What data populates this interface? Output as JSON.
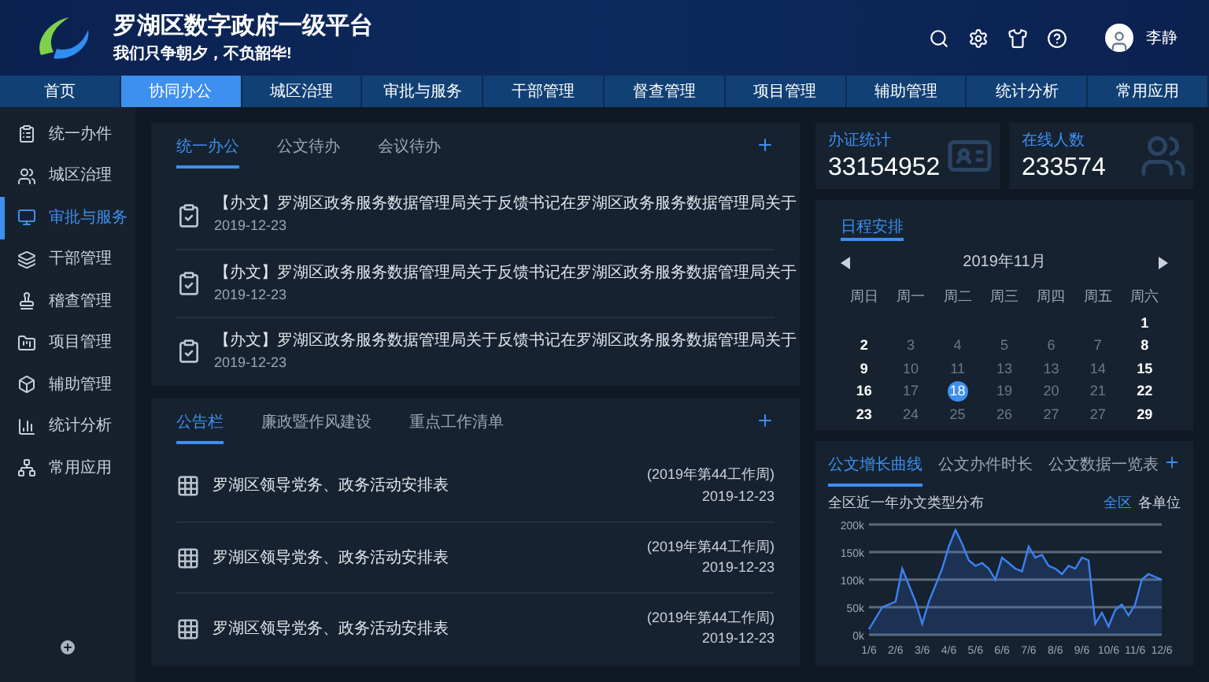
{
  "header": {
    "title": "罗湖区数字政府一级平台",
    "slogan": "我们只争朝夕，不负韶华!",
    "user": "李静"
  },
  "nav": [
    {
      "label": "首页",
      "selected": false
    },
    {
      "label": "协同办公",
      "selected": true
    },
    {
      "label": "城区治理",
      "selected": false
    },
    {
      "label": "审批与服务",
      "selected": false
    },
    {
      "label": "干部管理",
      "selected": false
    },
    {
      "label": "督查管理",
      "selected": false
    },
    {
      "label": "项目管理",
      "selected": false
    },
    {
      "label": "辅助管理",
      "selected": false
    },
    {
      "label": "统计分析",
      "selected": false
    },
    {
      "label": "常用应用",
      "selected": false
    }
  ],
  "sidebar": {
    "items": [
      {
        "label": "统一办件",
        "selected": false
      },
      {
        "label": "城区治理",
        "selected": false
      },
      {
        "label": "审批与服务",
        "selected": true
      },
      {
        "label": "干部管理",
        "selected": false
      },
      {
        "label": "稽查管理",
        "selected": false
      },
      {
        "label": "项目管理",
        "selected": false
      },
      {
        "label": "辅助管理",
        "selected": false
      },
      {
        "label": "统计分析",
        "selected": false
      },
      {
        "label": "常用应用",
        "selected": false
      }
    ]
  },
  "office": {
    "tabs": [
      {
        "label": "统一办公",
        "selected": true
      },
      {
        "label": "公文待办",
        "selected": false
      },
      {
        "label": "会议待办",
        "selected": false
      }
    ],
    "items": [
      {
        "title": "【办文】罗湖区政务服务数据管理局关于反馈书记在罗湖区政务服务数据管理局关于",
        "date": "2019-12-23"
      },
      {
        "title": "【办文】罗湖区政务服务数据管理局关于反馈书记在罗湖区政务服务数据管理局关于",
        "date": "2019-12-23"
      },
      {
        "title": "【办文】罗湖区政务服务数据管理局关于反馈书记在罗湖区政务服务数据管理局关于",
        "date": "2019-12-23"
      }
    ]
  },
  "notices": {
    "tabs": [
      {
        "label": "公告栏",
        "selected": true
      },
      {
        "label": "廉政暨作风建设",
        "selected": false
      },
      {
        "label": "重点工作清单",
        "selected": false
      }
    ],
    "items": [
      {
        "title": "罗湖区领导党务、政务活动安排表",
        "week": "(2019年第44工作周)",
        "date": "2019-12-23"
      },
      {
        "title": "罗湖区领导党务、政务活动安排表",
        "week": "(2019年第44工作周)",
        "date": "2019-12-23"
      },
      {
        "title": "罗湖区领导党务、政务活动安排表",
        "week": "(2019年第44工作周)",
        "date": "2019-12-23"
      }
    ]
  },
  "stats": [
    {
      "kind": "card",
      "label": "办证统计",
      "value": "33154952"
    },
    {
      "kind": "people",
      "label": "在线人数",
      "value": "233574"
    }
  ],
  "calendar": {
    "tab": "日程安排",
    "month": "2019年11月",
    "weekdays": [
      "周日",
      "周一",
      "周二",
      "周三",
      "周四",
      "周五",
      "周六"
    ],
    "weeks": [
      [
        {
          "label": "1",
          "selected": false
        }
      ],
      [
        {
          "label": "2",
          "selected": false
        },
        {
          "label": "3",
          "selected": false
        },
        {
          "label": "4",
          "selected": false
        },
        {
          "label": "5",
          "selected": false
        },
        {
          "label": "6",
          "selected": false
        },
        {
          "label": "7",
          "selected": false
        },
        {
          "label": "8",
          "selected": false
        }
      ],
      [
        {
          "label": "9",
          "selected": false
        },
        {
          "label": "10",
          "selected": false
        },
        {
          "label": "11",
          "selected": false
        },
        {
          "label": "13",
          "selected": false
        },
        {
          "label": "13",
          "selected": false
        },
        {
          "label": "14",
          "selected": false
        },
        {
          "label": "15",
          "selected": false
        }
      ],
      [
        {
          "label": "16",
          "selected": false
        },
        {
          "label": "17",
          "selected": false
        },
        {
          "label": "18",
          "selected": true
        },
        {
          "label": "19",
          "selected": false
        },
        {
          "label": "20",
          "selected": false
        },
        {
          "label": "21",
          "selected": false
        },
        {
          "label": "22",
          "selected": false
        }
      ],
      [
        {
          "label": "23",
          "selected": false
        },
        {
          "label": "24",
          "selected": false
        },
        {
          "label": "25",
          "selected": false
        },
        {
          "label": "26",
          "selected": false
        },
        {
          "label": "27",
          "selected": false
        },
        {
          "label": "27",
          "selected": false
        },
        {
          "label": "29",
          "selected": false
        }
      ]
    ]
  },
  "trend": {
    "tabs": [
      {
        "label": "公文增长曲线",
        "selected": true
      },
      {
        "label": "公文办件时长",
        "selected": false
      },
      {
        "label": "公文数据一览表",
        "selected": false
      }
    ],
    "subtitle": "全区近一年办文类型分布",
    "scopes": [
      {
        "label": "全区",
        "selected": true
      },
      {
        "label": "各单位",
        "selected": false
      }
    ],
    "chart_data": {
      "type": "area",
      "categories": [
        "1/6",
        null,
        null,
        null,
        "2/6",
        null,
        null,
        null,
        "3/6",
        null,
        null,
        null,
        "4/6",
        null,
        null,
        null,
        "5/6",
        null,
        null,
        null,
        "6/6",
        null,
        null,
        null,
        "7/6",
        null,
        null,
        null,
        "8/6",
        null,
        null,
        null,
        "9/6",
        null,
        null,
        null,
        "10/6",
        null,
        null,
        null,
        "11/6",
        null,
        null,
        null,
        "12/6"
      ],
      "series": [
        {
          "color": "#3b82f6",
          "values": [
            10,
            30,
            50,
            55,
            60,
            120,
            90,
            60,
            20,
            60,
            90,
            120,
            160,
            190,
            165,
            135,
            125,
            130,
            120,
            100,
            140,
            130,
            120,
            115,
            160,
            140,
            145,
            125,
            120,
            110,
            125,
            120,
            140,
            135,
            20,
            40,
            15,
            45,
            55,
            35,
            55,
            100,
            110,
            105,
            100
          ]
        }
      ],
      "ylim": [
        0,
        200
      ],
      "grid": true,
      "yticks": [
        {
          "value": 0,
          "label": "0k"
        },
        {
          "value": 50,
          "label": "50k"
        },
        {
          "value": 100,
          "label": "100k"
        },
        {
          "value": 150,
          "label": "150k"
        },
        {
          "value": 200,
          "label": "200k"
        }
      ]
    }
  }
}
